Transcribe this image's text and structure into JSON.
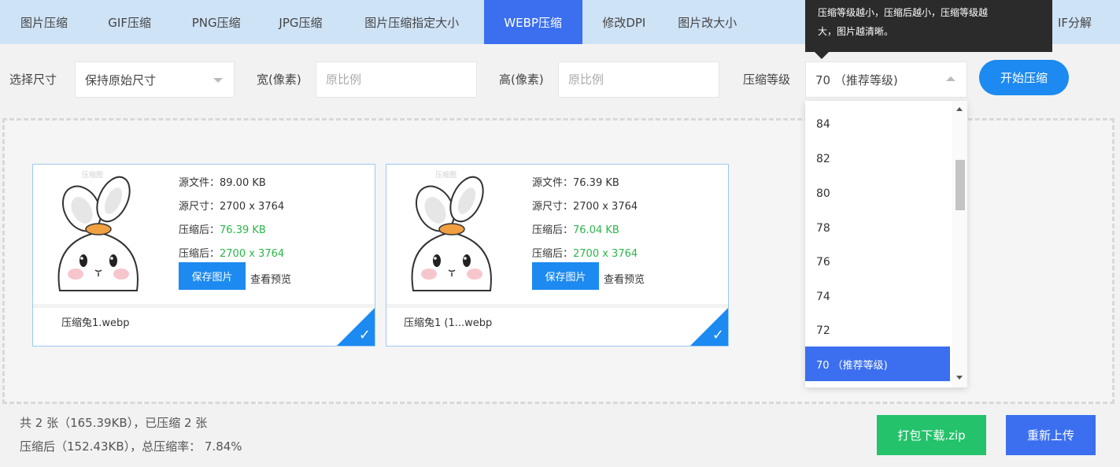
{
  "tabs": [
    "图片压缩",
    "GIF压缩",
    "PNG压缩",
    "JPG压缩",
    "图片压缩指定大小",
    "WEBP压缩",
    "修改DPI",
    "图片改大小",
    "IF分解"
  ],
  "active_tab": "WEBP压缩",
  "tooltip": {
    "line1": "压缩等级越小，压缩后越小，压缩等级越",
    "line2": "大，图片越清晰。"
  },
  "options": {
    "size_label": "选择尺寸",
    "size_value": "保持原始尺寸",
    "width_label": "宽(像素)",
    "width_placeholder": "原比例",
    "height_label": "高(像素)",
    "height_placeholder": "原比例",
    "level_label": "压缩等级",
    "level_value": "70 （推荐等级)",
    "start_button": "开始压缩"
  },
  "dropdown": {
    "items": [
      "84",
      "82",
      "80",
      "78",
      "76",
      "74",
      "72",
      "70 （推荐等级)"
    ],
    "selected": "70 （推荐等级)"
  },
  "files": [
    {
      "source_size": "源文件：89.00 KB",
      "source_dims": "源尺寸：2700 x 3764",
      "compressed_size_label": "压缩后：",
      "compressed_size": "76.39 KB",
      "compressed_dims_label": "压缩后：",
      "compressed_dims": "2700 x 3764",
      "save_button": "保存图片",
      "preview_link": "查看预览",
      "name": "压缩兔1.webp",
      "watermark": "压缩图"
    },
    {
      "source_size": "源文件：76.39 KB",
      "source_dims": "源尺寸：2700 x 3764",
      "compressed_size_label": "压缩后：",
      "compressed_size": "76.04 KB",
      "compressed_dims_label": "压缩后：",
      "compressed_dims": "2700 x 3764",
      "save_button": "保存图片",
      "preview_link": "查看预览",
      "name": "压缩兔1 (1...webp",
      "watermark": "压缩图"
    }
  ],
  "summary": {
    "line1": "共 2 张（165.39KB），已压缩 2 张",
    "line2": "压缩后（152.43KB），总压缩率： 7.84%"
  },
  "actions": {
    "zip_button": "打包下载.zip",
    "reupload_button": "重新上传"
  },
  "colors": {
    "primary": "#3b6ff0",
    "accent": "#1c8af0",
    "success": "#2bb64b",
    "zip": "#23c26b",
    "tab_bar": "#cfe3f7"
  }
}
